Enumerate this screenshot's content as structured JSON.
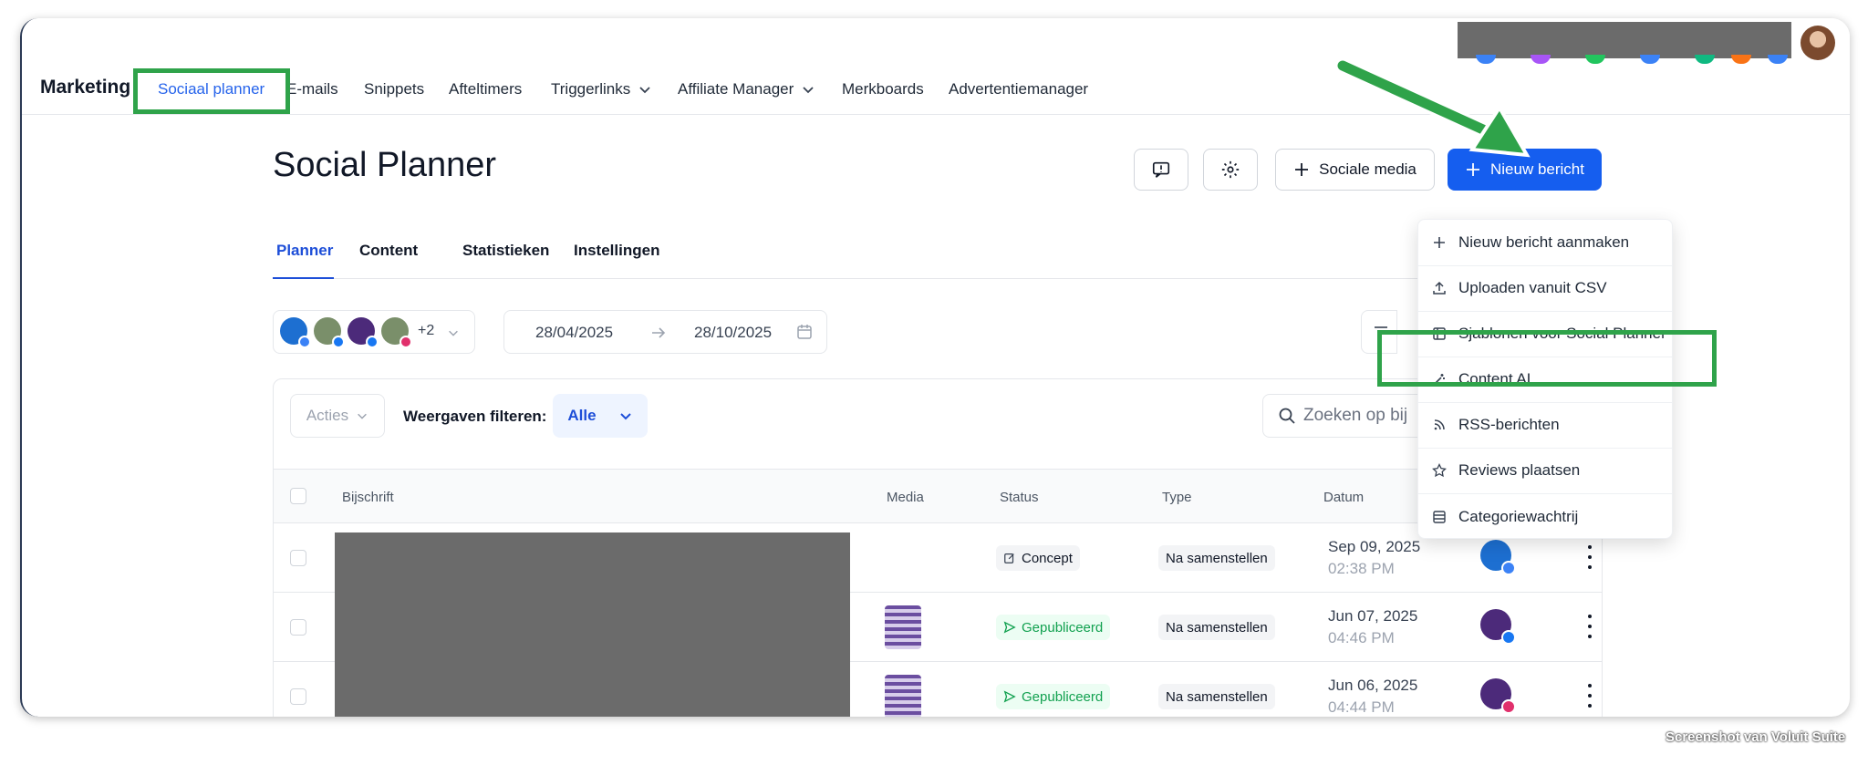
{
  "nav": {
    "brand": "Marketing",
    "items": [
      {
        "label": "Sociaal planner"
      },
      {
        "label": "E-mails"
      },
      {
        "label": "Snippets"
      },
      {
        "label": "Afteltimers"
      },
      {
        "label": "Triggerlinks"
      },
      {
        "label": "Affiliate Manager"
      },
      {
        "label": "Merkboards"
      },
      {
        "label": "Advertentiemanager"
      }
    ]
  },
  "header": {
    "title": "Social Planner",
    "social_media_label": "Sociale media",
    "new_post_label": "Nieuw bericht"
  },
  "tabs": [
    {
      "label": "Planner"
    },
    {
      "label": "Content"
    },
    {
      "label": "Statistieken"
    },
    {
      "label": "Instellingen"
    }
  ],
  "accounts": {
    "extra_count": "+2"
  },
  "date_range": {
    "start": "28/04/2025",
    "end": "28/10/2025"
  },
  "toolbar": {
    "actions_label": "Acties",
    "filter_label": "Weergaven filteren:",
    "filter_value": "Alle",
    "search_placeholder": "Zoeken op bij"
  },
  "table": {
    "columns": [
      "Bijschrift",
      "Media",
      "Status",
      "Type",
      "Datum"
    ],
    "rows": [
      {
        "status": "Concept",
        "type": "Na samenstellen",
        "date": "Sep 09, 2025",
        "time": "02:38 PM"
      },
      {
        "status": "Gepubliceerd",
        "type": "Na samenstellen",
        "date": "Jun 07, 2025",
        "time": "04:46 PM"
      },
      {
        "status": "Gepubliceerd",
        "type": "Na samenstellen",
        "date": "Jun 06, 2025",
        "time": "04:44 PM"
      }
    ]
  },
  "dropdown": {
    "items": [
      {
        "label": "Nieuw bericht aanmaken",
        "icon": "plus-icon"
      },
      {
        "label": "Uploaden vanuit CSV",
        "icon": "upload-icon"
      },
      {
        "label": "Sjablonen voor Social Planner",
        "icon": "template-icon"
      },
      {
        "label": "Content AI",
        "icon": "magic-wand-icon"
      },
      {
        "label": "RSS-berichten",
        "icon": "rss-icon"
      },
      {
        "label": "Reviews plaatsen",
        "icon": "star-icon"
      },
      {
        "label": "Categoriewachtrij",
        "icon": "list-icon"
      }
    ]
  },
  "watermark": "Screenshot van Voluit Suite",
  "colors": {
    "primary": "#155eef",
    "highlight": "#2fa34a",
    "published": "#12a150"
  }
}
